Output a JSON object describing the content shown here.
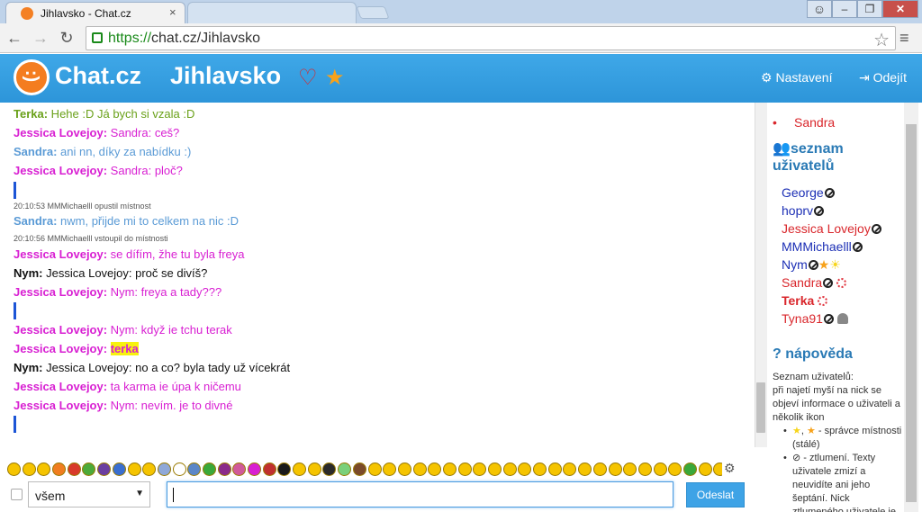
{
  "browser": {
    "tab_title": "Jihlavsko - Chat.cz",
    "tab_close": "×",
    "url_scheme": "https://",
    "url_rest": "chat.cz/Jihlavsko",
    "window_min": "–",
    "window_max": "❐",
    "window_close": "✕"
  },
  "header": {
    "logo_text": "Chat.cz",
    "room_name": "Jihlavsko",
    "settings_label": "Nastavení",
    "logout_label": "Odejít",
    "colors": {
      "header_blue": "#2d95d9",
      "logo_orange": "#f47d20"
    }
  },
  "chat": {
    "messages": [
      {
        "nick": "Terka:",
        "text": " Hehe :D Já bych si vzala :D",
        "color": "#6aa11a"
      },
      {
        "nick": "Jessica Lovejoy:",
        "text": " Sandra: ceš?",
        "color": "#d81fd2"
      },
      {
        "nick": "Sandra:",
        "text": " ani nn, díky za nabídku :)",
        "color": "#5b9bd6"
      },
      {
        "nick": "Jessica Lovejoy:",
        "text": " Sandra: ploč?",
        "color": "#d81fd2"
      },
      {
        "sys": "20:10:53 MMMichaelll opustil místnost"
      },
      {
        "nick": "Sandra:",
        "text": " nwm, přijde mi to celkem na nic :D",
        "color": "#5b9bd6"
      },
      {
        "sys": "20:10:56 MMMichaelll vstoupil do místnosti"
      },
      {
        "nick": "Jessica Lovejoy:",
        "text": " se dífím, žhe tu byla freya",
        "color": "#d81fd2"
      },
      {
        "nick": "Nym:",
        "text": " Jessica Lovejoy: proč se divíš?",
        "color": "#111111"
      },
      {
        "nick": "Jessica Lovejoy:",
        "text": " Nym: freya a tady???",
        "color": "#d81fd2"
      },
      {
        "nick": "Jessica Lovejoy:",
        "text": " Nym: když ie tchu terak",
        "color": "#d81fd2"
      },
      {
        "nick": "Jessica Lovejoy:",
        "text": "terka",
        "color": "#d81fd2"
      },
      {
        "nick": "Nym:",
        "text": " Jessica Lovejoy: no a co? byla tady už vícekrát",
        "color": "#111111"
      },
      {
        "nick": "Jessica Lovejoy:",
        "text": " ta karma ie úpa k ničemu",
        "color": "#d81fd2"
      },
      {
        "nick": "Jessica Lovejoy:",
        "text": " Nym: nevím. je to divné",
        "color": "#d81fd2"
      }
    ]
  },
  "sidebar": {
    "remaining_name": "Sandra",
    "users_heading": "seznam uživatelů",
    "users": [
      {
        "name": "George",
        "color": "#1c2fb5"
      },
      {
        "name": "hoprv",
        "color": "#1c2fb5"
      },
      {
        "name": "Jessica Lovejoy",
        "color": "#d9262b"
      },
      {
        "name": "MMMichaelll",
        "color": "#1c2fb5"
      },
      {
        "name": "Nym",
        "color": "#1c2fb5"
      },
      {
        "name": "Sandra",
        "color": "#d9262b"
      },
      {
        "name": "Terka",
        "color": "#d9262b"
      },
      {
        "name": "Tyna91",
        "color": "#d9262b"
      }
    ],
    "help_heading": "nápověda",
    "help_intro": "Seznam uživatelů:",
    "help_text": "při najetí myší na nick se objeví informace o uživateli a několik ikon",
    "help_item_1": " - správce místnosti (stálé)",
    "help_item_2": " - ztlumení. Texty uživatele zmizí a neuvidíte ani jeho šeptání. Nick ztlumeného uživatele je přeškrtnutý"
  },
  "composer": {
    "target_value": "všem",
    "send_label": "Odeslat",
    "emoji_colors": [
      "#f5c400",
      "#f5c400",
      "#f5c400",
      "#f07d20",
      "#d83a2a",
      "#4caa3a",
      "#6b3ea0",
      "#3a6fd0",
      "#f5c400",
      "#f5c400",
      "#8fa8d8",
      "#ffffff",
      "#5a86c7",
      "#3aa83a",
      "#8a2a8a",
      "#d05a9a",
      "#d81fd2",
      "#c03030",
      "#1a1a1a",
      "#f5c400",
      "#f5c400",
      "#2a2a2a",
      "#7ad07a",
      "#7a4a2a",
      "#f5c400",
      "#f5c400",
      "#f5c400",
      "#f5c400",
      "#f5c400",
      "#f5c400",
      "#f5c400",
      "#f5c400",
      "#f5c400",
      "#f5c400",
      "#f5c400",
      "#f5c400",
      "#f5c400",
      "#f5c400",
      "#f5c400",
      "#f5c400",
      "#f5c400",
      "#f5c400",
      "#f5c400",
      "#f5c400",
      "#f5c400",
      "#3aa83a",
      "#f5c400",
      "#f5c400",
      "#f5c400",
      "#f5c400",
      "#f5c400"
    ]
  }
}
